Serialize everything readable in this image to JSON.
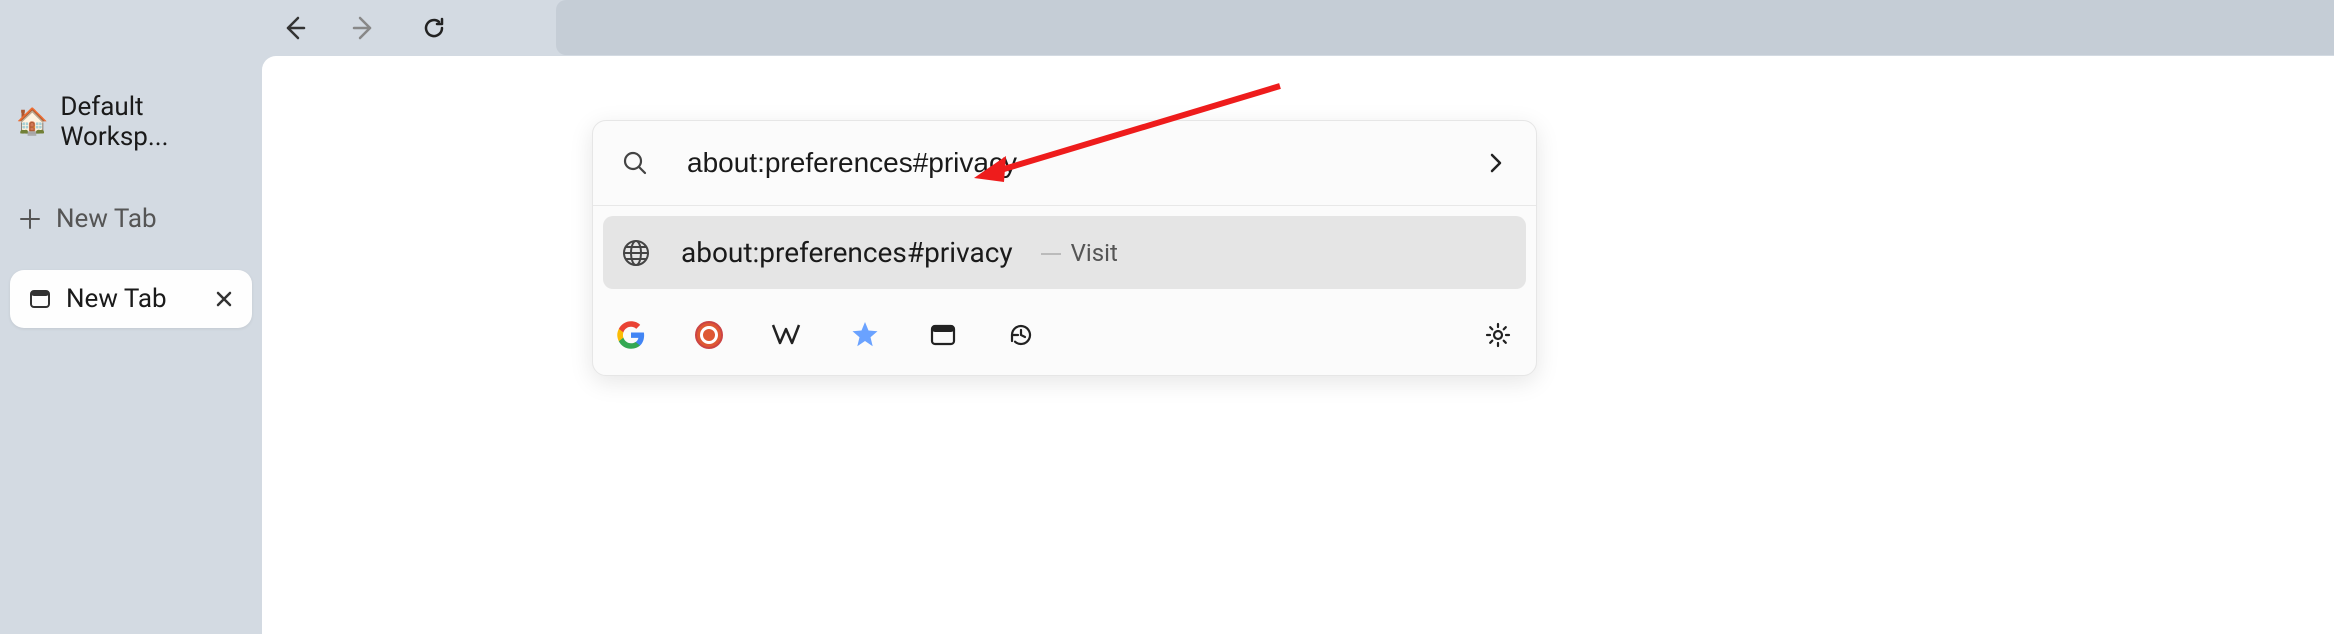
{
  "sidebar": {
    "workspace_label": "Default Worksp...",
    "new_tab_button_label": "New Tab",
    "tabs": [
      {
        "label": "New Tab"
      }
    ]
  },
  "nav": {
    "back": "Back",
    "forward": "Forward",
    "reload": "Reload"
  },
  "url_input": {
    "value": "about:preferences#privacy"
  },
  "suggestion": {
    "url": "about:preferences#privacy",
    "action": "Visit"
  },
  "search_engines": {
    "google": "Google",
    "duckduckgo": "DuckDuckGo",
    "wikipedia": "Wikipedia",
    "bookmarks": "Bookmarks",
    "tabs": "Tabs",
    "history": "History",
    "settings": "Search settings"
  },
  "colors": {
    "arrow": "#ee1c1c",
    "sidebar_bg": "#d3dae2",
    "suggestion_bg": "#e5e5e5"
  }
}
